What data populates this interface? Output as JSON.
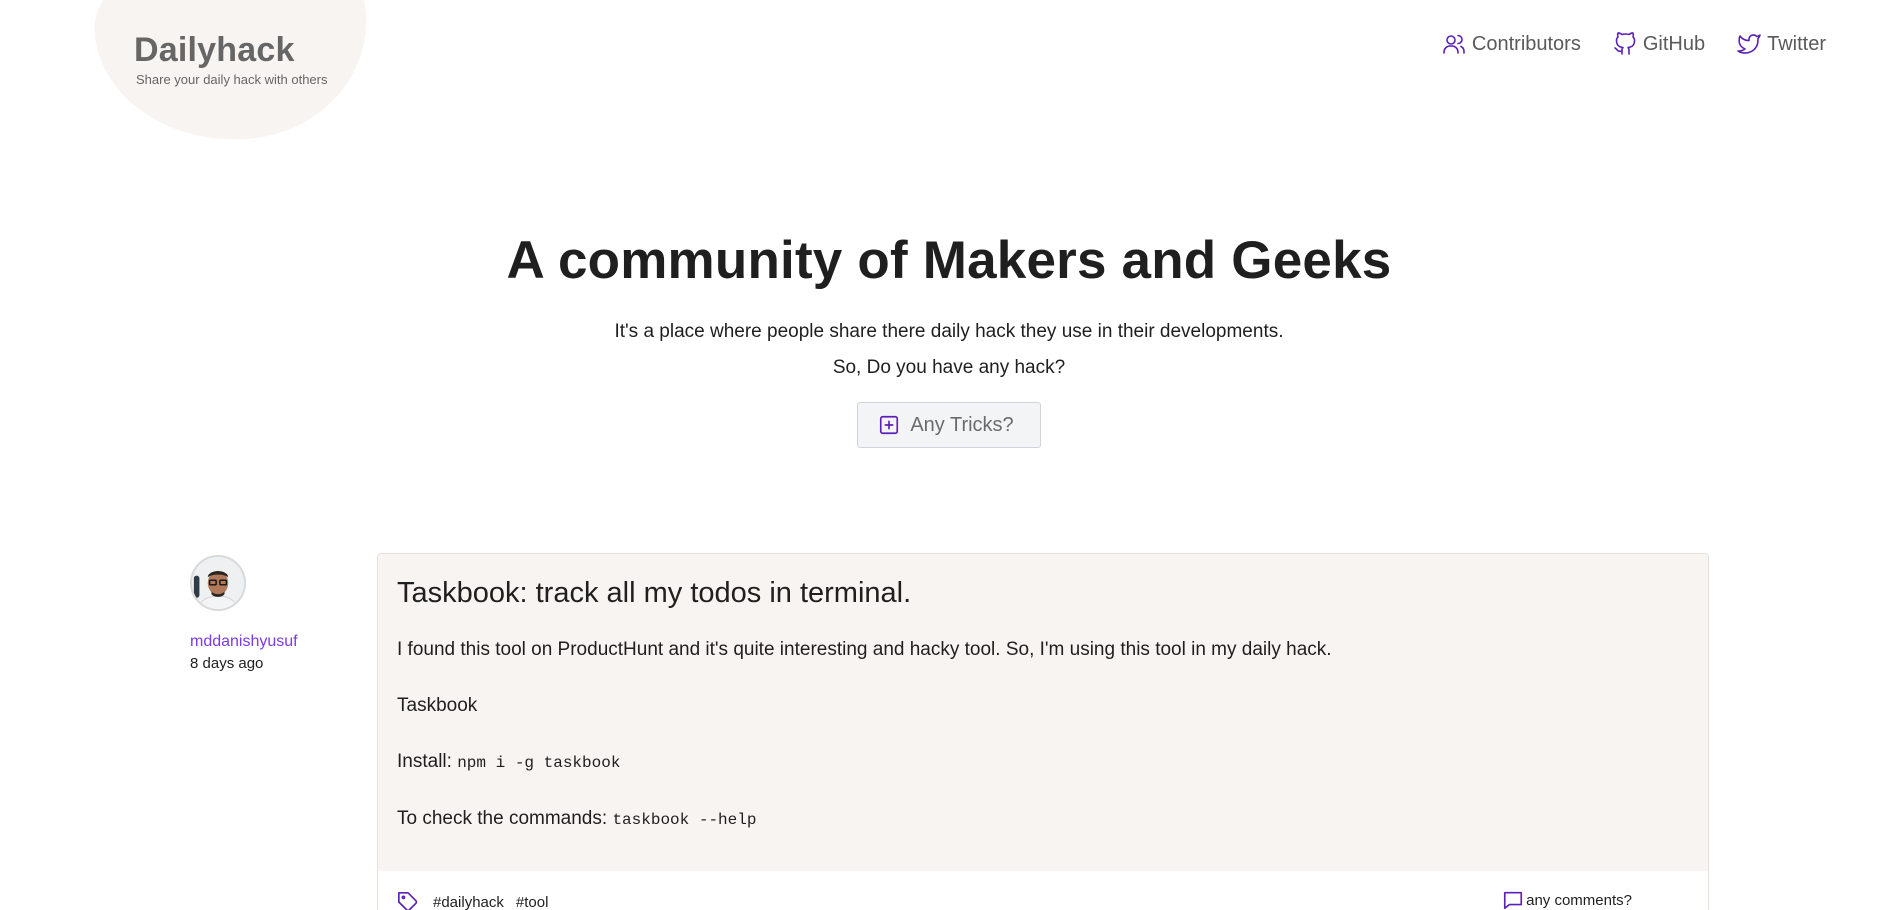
{
  "header": {
    "logo_title": "Dailyhack",
    "logo_tagline": "Share your daily hack with others",
    "nav": [
      {
        "label": "Contributors",
        "icon": "users-icon"
      },
      {
        "label": "GitHub",
        "icon": "github-icon"
      },
      {
        "label": "Twitter",
        "icon": "twitter-icon"
      }
    ]
  },
  "hero": {
    "title": "A community of Makers and Geeks",
    "line1": "It's a place where people share there daily hack they use in their developments.",
    "line2": "So, Do you have any hack?",
    "button_label": "Any Tricks?"
  },
  "post": {
    "author": "mddanishyusuf",
    "time": "8 days ago",
    "title": "Taskbook: track all my todos in terminal.",
    "intro": "I found this tool on ProductHunt and it's quite interesting and hacky tool. So, I'm using this tool in my daily hack.",
    "name": "Taskbook",
    "install_label": "Install:",
    "install_code": "npm i -g taskbook",
    "commands_label": "To check the commands:",
    "commands_code": "taskbook --help",
    "tags": [
      "#dailyhack",
      "#tool"
    ],
    "comments_label": "any comments?"
  },
  "colors": {
    "accent": "#5b21b6",
    "author_link": "#7c3aed",
    "card_bg": "#f8f4f1",
    "logo_blob": "#f8f4f1"
  }
}
